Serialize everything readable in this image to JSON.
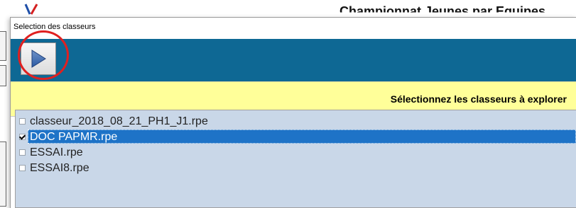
{
  "background_app": {
    "title": "Championnat Jeunes par Equipes"
  },
  "dialog": {
    "title": "Selection des classeurs",
    "banner_text": "Sélectionnez les classeurs à explorer",
    "files": [
      {
        "name": "classeur_2018_08_21_PH1_J1.rpe",
        "checked": false,
        "selected": false
      },
      {
        "name": "DOC PAPMR.rpe",
        "checked": true,
        "selected": true
      },
      {
        "name": "ESSAI.rpe",
        "checked": false,
        "selected": false
      },
      {
        "name": "ESSAI8.rpe",
        "checked": false,
        "selected": false
      }
    ]
  },
  "colors": {
    "toolbar": "#0e6894",
    "banner": "#ffff99",
    "list_background": "#c9d7e8",
    "selection": "#1e73c7",
    "highlight_circle": "#e02020"
  },
  "icons": {
    "play": "play-icon",
    "logo": "logo-icon"
  }
}
